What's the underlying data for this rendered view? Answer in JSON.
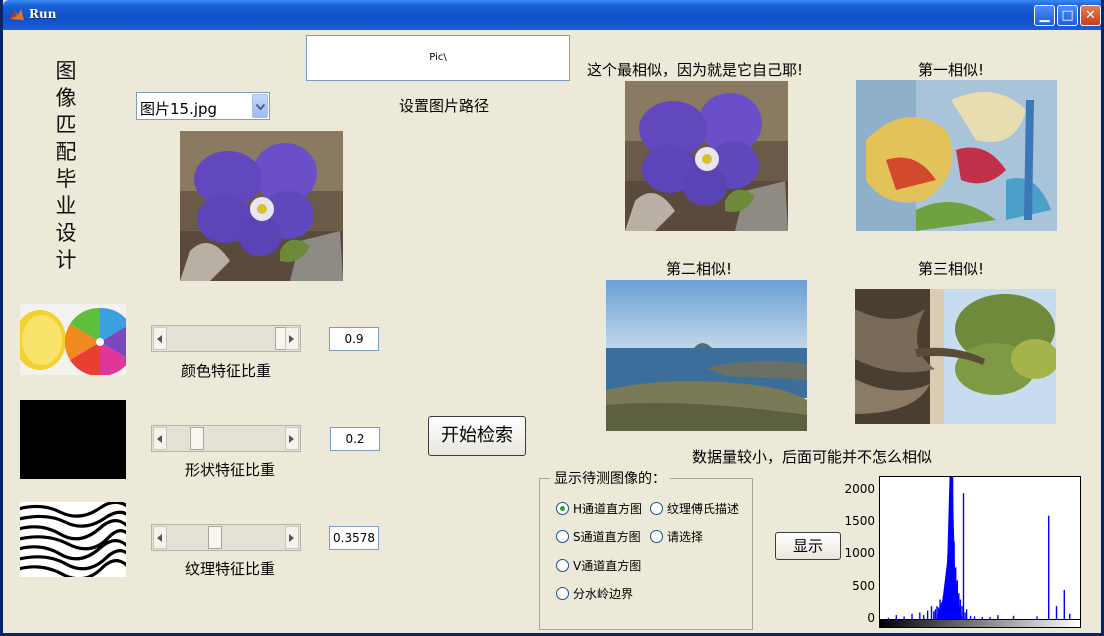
{
  "window": {
    "title": "Run"
  },
  "sidebar_title": "图像匹配毕业设计",
  "image_selector": {
    "value": "图片15.jpg"
  },
  "path": {
    "value": "Pic\\",
    "label": "设置图片路径"
  },
  "captions": {
    "best": "这个最相似，因为就是它自己耶!",
    "first": "第一相似!",
    "second": "第二相似!",
    "third": "第三相似!",
    "note": "数据量较小，后面可能并不怎么相似"
  },
  "features": [
    {
      "label": "颜色特征比重",
      "value": "0.9",
      "level": 0.9
    },
    {
      "label": "形状特征比重",
      "value": "0.2",
      "level": 0.2
    },
    {
      "label": "纹理特征比重",
      "value": "0.3578",
      "level": 0.3578
    }
  ],
  "search_button": "开始检索",
  "display_group": {
    "title": "显示待测图像的：",
    "options": [
      {
        "label": "H通道直方图",
        "selected": true
      },
      {
        "label": "纹理傅氏描述",
        "selected": false
      },
      {
        "label": "S通道直方图",
        "selected": false
      },
      {
        "label": "请选择",
        "selected": false
      },
      {
        "label": "V通道直方图",
        "selected": false
      },
      {
        "label": "分水岭边界",
        "selected": false
      }
    ]
  },
  "show_button": "显示",
  "chart_data": {
    "type": "bar",
    "title": "",
    "xlabel": "",
    "ylabel": "",
    "xlim": [
      0,
      256
    ],
    "ylim": [
      0,
      2200
    ],
    "yticks": [
      0,
      500,
      1000,
      1500,
      2000
    ],
    "series": [
      {
        "color": "#0000ff",
        "x": [
          10,
          20,
          30,
          40,
          50,
          55,
          60,
          65,
          68,
          70,
          72,
          74,
          76,
          78,
          80,
          82,
          84,
          86,
          88,
          90,
          92,
          94,
          96,
          98,
          100,
          102,
          104,
          106,
          108,
          110,
          115,
          120,
          130,
          140,
          150,
          170,
          200,
          215,
          225,
          235,
          242
        ],
        "values": [
          20,
          60,
          40,
          80,
          100,
          60,
          130,
          200,
          120,
          150,
          200,
          180,
          300,
          250,
          350,
          500,
          700,
          1000,
          1500,
          2200,
          2200,
          1200,
          800,
          600,
          400,
          300,
          200,
          1950,
          100,
          150,
          50,
          40,
          30,
          30,
          60,
          50,
          40,
          1600,
          200,
          450,
          80
        ]
      }
    ]
  },
  "colors": {
    "title_bar": "#0f4fc7",
    "window_bg": "#ece9d8",
    "hist_bar": "#0000ff"
  }
}
